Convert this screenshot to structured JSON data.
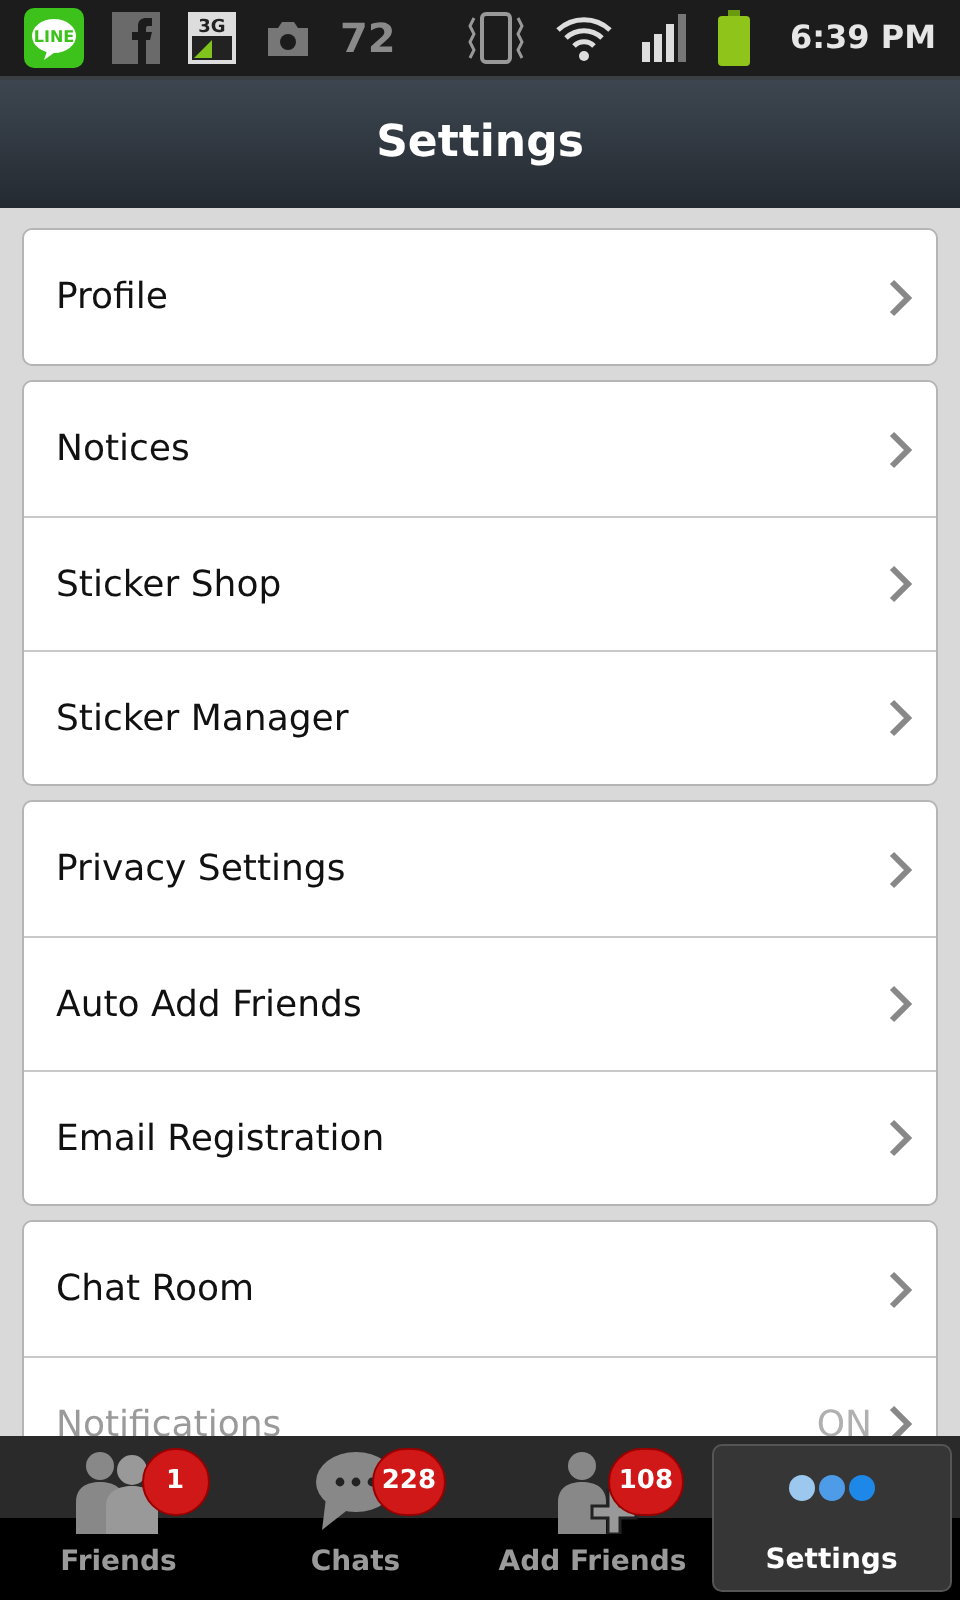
{
  "status_bar": {
    "app_badge": "LINE",
    "network": "3G",
    "temperature": "72",
    "time": "6:39 PM"
  },
  "header": {
    "title": "Settings"
  },
  "groups": [
    {
      "items": [
        {
          "label": "Profile",
          "disabled": false
        }
      ]
    },
    {
      "items": [
        {
          "label": "Notices",
          "disabled": false
        },
        {
          "label": "Sticker Shop",
          "disabled": false
        },
        {
          "label": "Sticker Manager",
          "disabled": false
        }
      ]
    },
    {
      "items": [
        {
          "label": "Privacy Settings",
          "disabled": false
        },
        {
          "label": "Auto Add Friends",
          "disabled": false
        },
        {
          "label": "Email Registration",
          "disabled": false
        }
      ]
    },
    {
      "items": [
        {
          "label": "Chat Room",
          "disabled": false
        },
        {
          "label": "Notifications",
          "value": "ON",
          "disabled": true
        }
      ]
    }
  ],
  "tab_bar": [
    {
      "kind": "friends",
      "label": "Friends",
      "badge": "1",
      "selected": false
    },
    {
      "kind": "chats",
      "label": "Chats",
      "badge": "228",
      "selected": false
    },
    {
      "kind": "add",
      "label": "Add Friends",
      "badge": "108",
      "selected": false
    },
    {
      "kind": "settings",
      "label": "Settings",
      "selected": true
    }
  ]
}
